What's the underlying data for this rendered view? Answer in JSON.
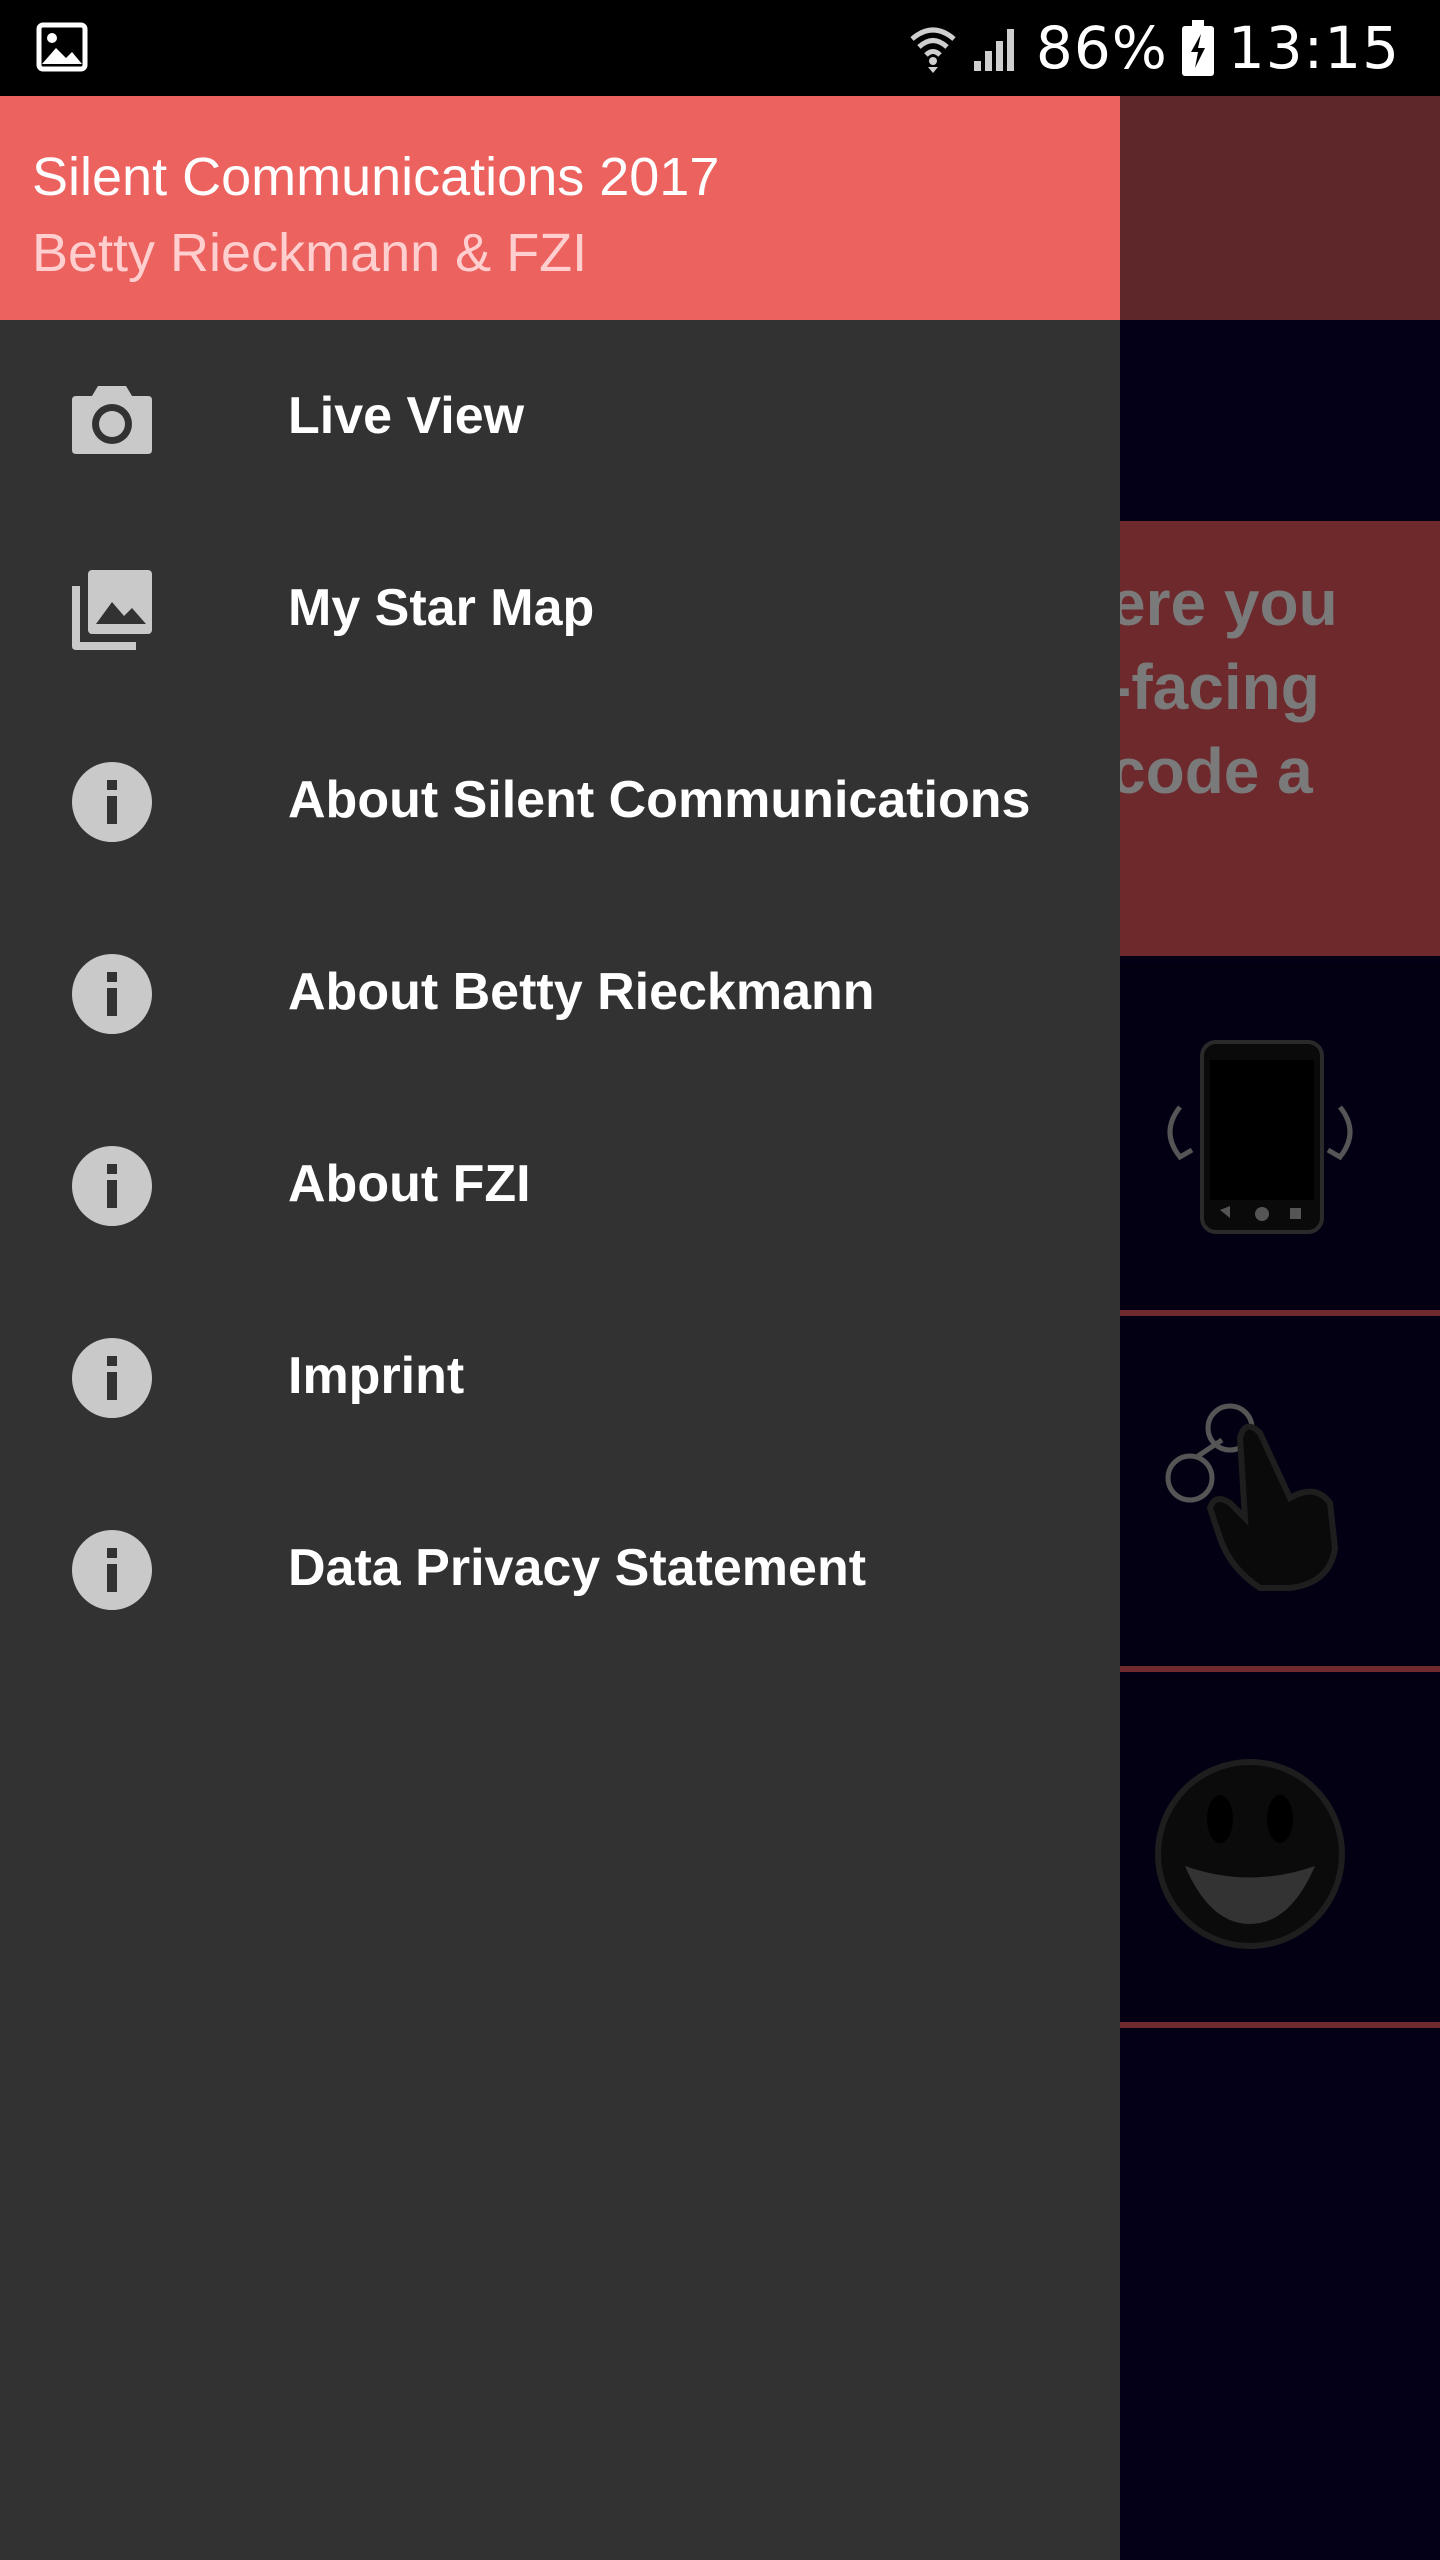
{
  "status_bar": {
    "battery": "86%",
    "time": "13:15",
    "icons": [
      "image-notification-icon",
      "wifi-icon",
      "signal-icon",
      "battery-charging-icon"
    ]
  },
  "background": {
    "banner_text": "ere you\n-facing\ncode a"
  },
  "drawer": {
    "title": "Silent Communications 2017",
    "subtitle": "Betty Rieckmann & FZI",
    "header_color": "#ec625f",
    "items": [
      {
        "label": "Live View",
        "icon": "camera-icon"
      },
      {
        "label": "My Star Map",
        "icon": "gallery-icon"
      },
      {
        "label": "About Silent Communications",
        "icon": "info-icon"
      },
      {
        "label": "About Betty Rieckmann",
        "icon": "info-icon"
      },
      {
        "label": "About FZI",
        "icon": "info-icon"
      },
      {
        "label": "Imprint",
        "icon": "info-icon"
      },
      {
        "label": "Data Privacy Statement",
        "icon": "info-icon"
      }
    ]
  }
}
